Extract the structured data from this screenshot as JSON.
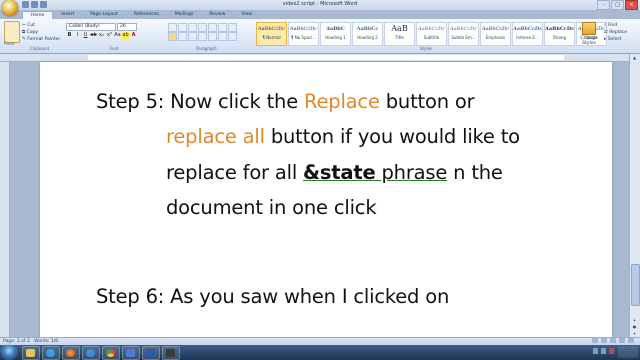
{
  "window": {
    "title": "video2 script - Microsoft Word"
  },
  "ribbon": {
    "tabs": [
      "Home",
      "Insert",
      "Page Layout",
      "References",
      "Mailings",
      "Review",
      "View"
    ],
    "active_tab": "Home",
    "clipboard": {
      "paste": "Paste",
      "cut": "Cut",
      "copy": "Copy",
      "format_painter": "Format Painter",
      "group": "Clipboard"
    },
    "font": {
      "name": "Calibri (Body)",
      "size": "26",
      "group": "Font"
    },
    "paragraph": {
      "group": "Paragraph"
    },
    "styles": {
      "group": "Styles",
      "items": [
        {
          "preview": "AaBbCcDc",
          "name": "¶ Normal"
        },
        {
          "preview": "AaBbCcDc",
          "name": "¶ No Spaci..."
        },
        {
          "preview": "AaBbC",
          "name": "Heading 1"
        },
        {
          "preview": "AaBbCc",
          "name": "Heading 2"
        },
        {
          "preview": "AaB",
          "name": "Title"
        },
        {
          "preview": "AaBbCcDc",
          "name": "Subtitle"
        },
        {
          "preview": "AaBbCcDc",
          "name": "Subtle Em..."
        },
        {
          "preview": "AaBbCcDc",
          "name": "Emphasis"
        },
        {
          "preview": "AaBbCcDc",
          "name": "Intense E..."
        },
        {
          "preview": "AaBbCcDc",
          "name": "Strong"
        },
        {
          "preview": "AaBbCcDc",
          "name": "Quote"
        }
      ],
      "change_styles": "Change Styles"
    },
    "editing": {
      "find": "Find",
      "replace": "Replace",
      "select": "Select"
    }
  },
  "document": {
    "line1_prefix": "Step 5: Now click the ",
    "line1_highlight": "Replace",
    "line1_suffix": " button or",
    "line2_highlight": "replace all",
    "line2_suffix": " button if you would like to",
    "line3_prefix": "replace for all ",
    "line3_bold": "&state",
    "line3_underlined": " phrase",
    "line3_suffix": " n the",
    "line4": "document in one click",
    "line5": "Step 6: As you saw when I clicked on"
  },
  "status": {
    "page": "Page: 3 of 3",
    "words": "Words: 1/6"
  },
  "colors": {
    "highlight": "#de8a2a",
    "ribbon": "#dde8f6",
    "taskbar": "#1d3654"
  }
}
